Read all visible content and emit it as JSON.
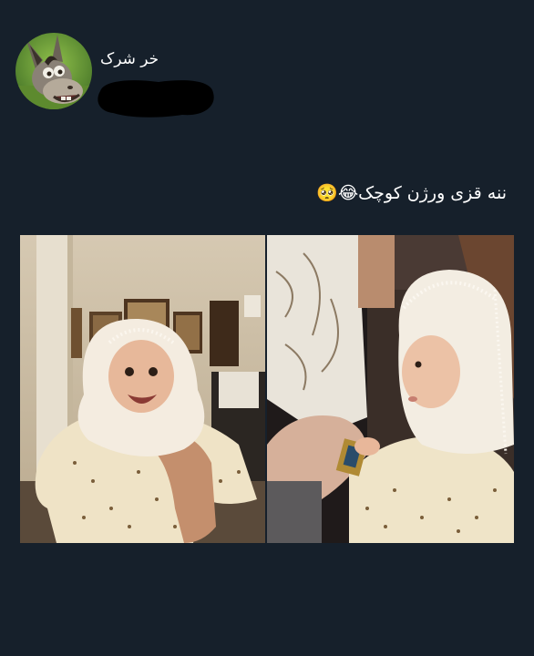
{
  "post": {
    "author": {
      "display_name": "خر شرک",
      "avatar_icon": "donkey-avatar-icon",
      "handle_redacted": true
    },
    "text": "ننه قزی ورژن کوچک😂🥺",
    "media": [
      {
        "name": "photo-baby-smiling-in-lace-headscarf"
      },
      {
        "name": "photo-baby-holding-object-in-lace-headscarf"
      }
    ]
  },
  "colors": {
    "background": "#16202b",
    "text": "#ffffff",
    "redaction": "#000000"
  }
}
